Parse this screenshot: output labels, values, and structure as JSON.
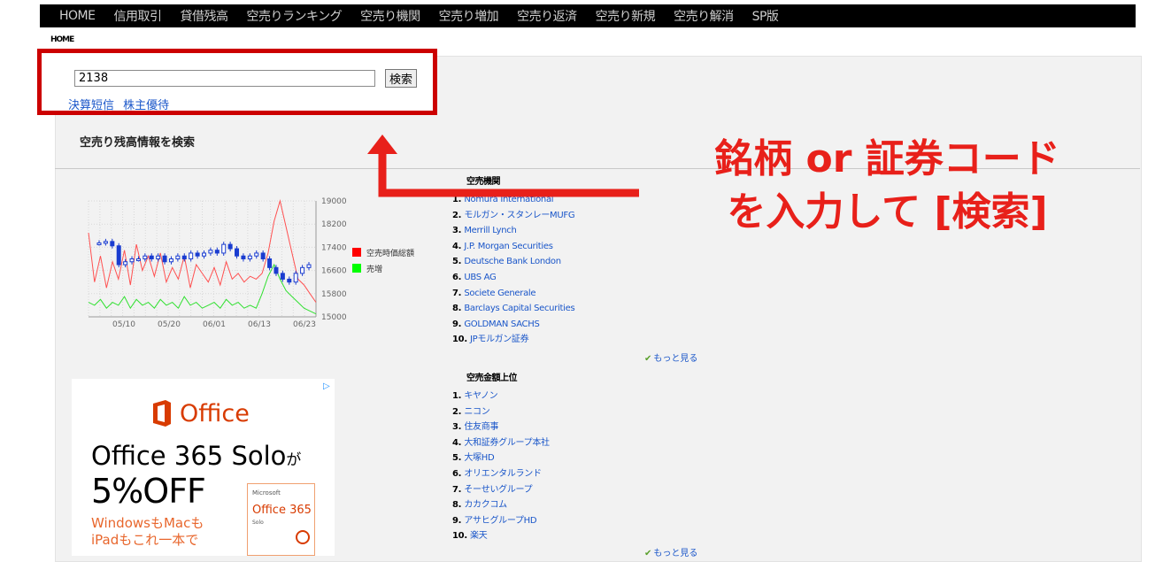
{
  "topnav": [
    "HOME",
    "信用取引",
    "貸借残高",
    "空売りランキング",
    "空売り機関",
    "空売り増加",
    "空売り返済",
    "空売り新規",
    "空売り解消",
    "SP版"
  ],
  "breadcrumb": "HOME",
  "search": {
    "value": "2138",
    "button": "検索"
  },
  "sublinks": [
    "決算短信",
    "株主優待"
  ],
  "section_title": "空売り残高情報を検索",
  "chart_data": {
    "type": "line",
    "x_ticks": [
      "05/10",
      "05/20",
      "06/01",
      "06/13",
      "06/23"
    ],
    "y_ticks": [
      19000,
      18200,
      17400,
      16600,
      15800,
      15000
    ],
    "ylim": [
      15000,
      19000
    ],
    "legend": [
      {
        "name": "空売時価総額",
        "color": "#ff0000"
      },
      {
        "name": "売増",
        "color": "#00ff00"
      }
    ],
    "series": [
      {
        "name": "空売時価総額",
        "color": "#ff5050",
        "values": [
          17900,
          16200,
          17100,
          16000,
          16900,
          16300,
          17300,
          16100,
          17500,
          16600,
          17100,
          16400,
          17200,
          16200,
          16700,
          16300,
          17100,
          16000,
          16800,
          16500,
          16200,
          16700,
          16100,
          16900,
          16300,
          16500,
          16200,
          16400,
          16300,
          16500,
          17200,
          18300,
          19000,
          18100,
          17200,
          16300,
          16100,
          15800,
          15500
        ]
      },
      {
        "name": "売増",
        "color": "#30e030",
        "values": [
          15500,
          15400,
          15600,
          15300,
          15500,
          15400,
          15700,
          15300,
          15600,
          15400,
          15500,
          15300,
          15600,
          15400,
          15500,
          15300,
          15700,
          15400,
          15500,
          15300,
          15400,
          15500,
          15300,
          15600,
          15400,
          15500,
          15300,
          15400,
          15300,
          15800,
          16400,
          16800,
          16300,
          15900,
          15700,
          15500,
          15300,
          15200,
          15100
        ]
      }
    ],
    "price_candles": [
      17550,
      17600,
      17450,
      16800,
      16900,
      17000,
      17000,
      17100,
      17000,
      17100,
      16900,
      17000,
      17100,
      17000,
      17200,
      17100,
      17200,
      17300,
      17200,
      17500,
      17350,
      17100,
      17000,
      17100,
      17200,
      17000,
      16700,
      16500,
      16300,
      16200,
      16500,
      16700,
      16800
    ]
  },
  "institutions": {
    "title": "空売機関",
    "items": [
      "Nomura International",
      "モルガン・スタンレーMUFG",
      "Merrill Lynch",
      "J.P. Morgan Securities",
      "Deutsche Bank London",
      "UBS AG",
      "Societe Generale",
      "Barclays Capital Securities",
      "GOLDMAN SACHS",
      "JPモルガン証券"
    ],
    "more": "もっと見る"
  },
  "top_amount": {
    "title": "空売金額上位",
    "items": [
      "キヤノン",
      "ニコン",
      "住友商事",
      "大和証券グループ本社",
      "大塚HD",
      "オリエンタルランド",
      "そーせいグループ",
      "カカクコム",
      "アサヒグループHD",
      "楽天"
    ],
    "more": "もっと見る"
  },
  "annotation": {
    "line1": "銘柄 or 証券コード",
    "line2": "を入力して [検索]"
  },
  "ad": {
    "brand": "Office",
    "line1": "Office 365 Solo",
    "line1_suffix": "が",
    "line2": "5%OFF",
    "line3a": "WindowsもMacも",
    "line3b": "iPadもこれ一本で",
    "box_ms": "Microsoft",
    "box_prod": "Office 365",
    "box_solo": "Solo"
  },
  "colors": {
    "annotation": "#e8201a",
    "frame": "#cc0000",
    "link": "#1a56c9"
  }
}
